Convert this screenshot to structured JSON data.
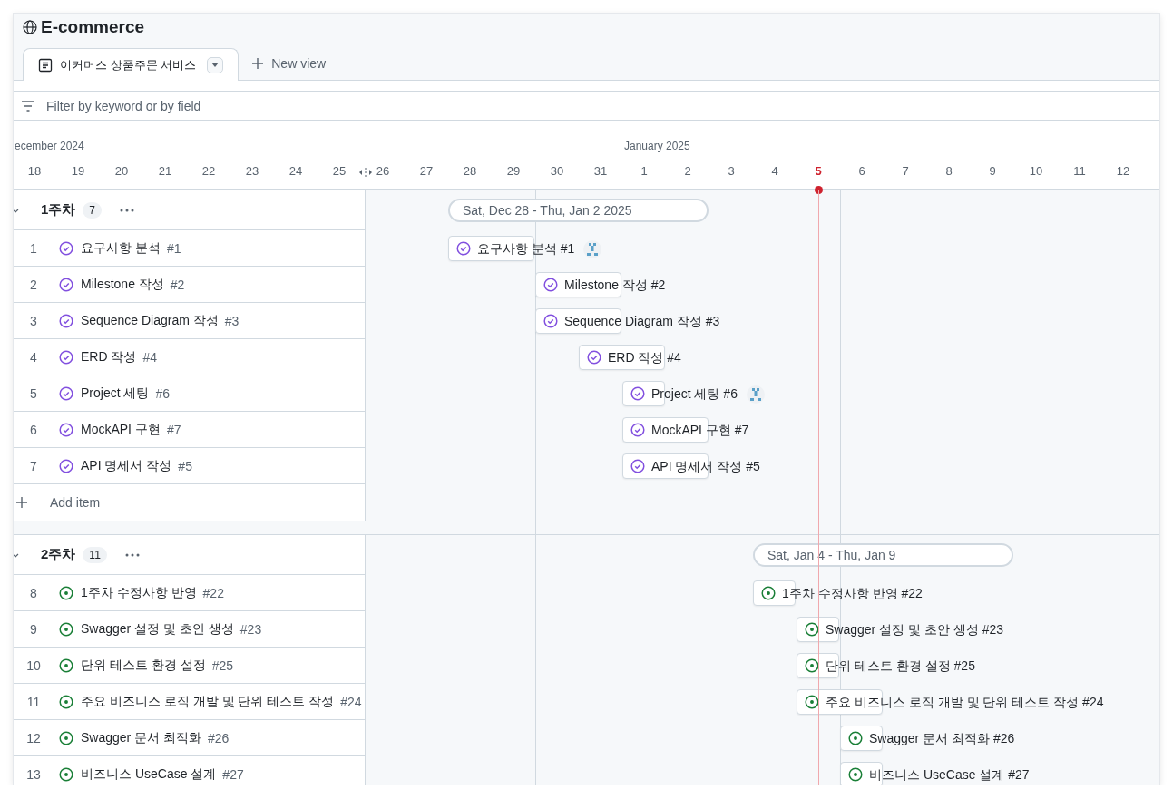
{
  "project": {
    "title": "E-commerce"
  },
  "views": [
    {
      "label": "이커머스 상품주문 서비스",
      "selected": true
    }
  ],
  "new_view": {
    "label": "New view"
  },
  "filter": {
    "placeholder": "Filter by keyword or by field"
  },
  "timeline": {
    "days": [
      {
        "label": "18",
        "today": false,
        "week_start": false,
        "month": "ecember 2024"
      },
      {
        "label": "19",
        "today": false,
        "week_start": false
      },
      {
        "label": "20",
        "today": false,
        "week_start": false
      },
      {
        "label": "21",
        "today": false,
        "week_start": false
      },
      {
        "label": "22",
        "today": false,
        "week_start": false
      },
      {
        "label": "23",
        "today": false,
        "week_start": false
      },
      {
        "label": "24",
        "today": false,
        "week_start": false
      },
      {
        "label": "25",
        "today": false,
        "week_start": false
      },
      {
        "label": "26",
        "today": false,
        "week_start": false
      },
      {
        "label": "27",
        "today": false,
        "week_start": false
      },
      {
        "label": "28",
        "today": false,
        "week_start": false
      },
      {
        "label": "29",
        "today": false,
        "week_start": false
      },
      {
        "label": "30",
        "today": false,
        "week_start": true
      },
      {
        "label": "31",
        "today": false,
        "week_start": false
      },
      {
        "label": "1",
        "today": false,
        "week_start": false,
        "month": "January 2025"
      },
      {
        "label": "2",
        "today": false,
        "week_start": false
      },
      {
        "label": "3",
        "today": false,
        "week_start": false
      },
      {
        "label": "4",
        "today": false,
        "week_start": false
      },
      {
        "label": "5",
        "today": true,
        "week_start": false
      },
      {
        "label": "6",
        "today": false,
        "week_start": true
      },
      {
        "label": "7",
        "today": false,
        "week_start": false
      },
      {
        "label": "8",
        "today": false,
        "week_start": false
      },
      {
        "label": "9",
        "today": false,
        "week_start": false
      },
      {
        "label": "10",
        "today": false,
        "week_start": false
      },
      {
        "label": "11",
        "today": false,
        "week_start": false
      },
      {
        "label": "12",
        "today": false,
        "week_start": false
      }
    ]
  },
  "groups": [
    {
      "title": "1주차",
      "count": "7",
      "expanded": true,
      "range": "Sat, Dec 28 - Thu, Jan 2 2025",
      "add_item": "Add item",
      "schedule": [
        false,
        false,
        true,
        true,
        true,
        true,
        true,
        true,
        false,
        false,
        false,
        false,
        false,
        false,
        false,
        false,
        false,
        false
      ],
      "items": [
        {
          "number": "1",
          "title": "요구사항 분석",
          "ref": "#1",
          "bar_label": "요구사항 분석 #1",
          "kind": "closed",
          "assigned": true,
          "schedule": [
            false,
            false,
            true,
            true,
            false,
            false,
            false,
            false,
            false,
            false,
            false,
            false,
            false,
            false,
            false,
            false,
            false,
            false
          ]
        },
        {
          "number": "2",
          "title": "Milestone 작성",
          "ref": "#2",
          "bar_label": "Milestone 작성 #2",
          "kind": "closed",
          "assigned": false,
          "schedule": [
            false,
            false,
            false,
            false,
            true,
            true,
            false,
            false,
            false,
            false,
            false,
            false,
            false,
            false,
            false,
            false,
            false,
            false
          ]
        },
        {
          "number": "3",
          "title": "Sequence Diagram 작성",
          "ref": "#3",
          "bar_label": "Sequence Diagram 작성 #3",
          "kind": "closed",
          "assigned": false,
          "schedule": [
            false,
            false,
            false,
            false,
            true,
            true,
            false,
            false,
            false,
            false,
            false,
            false,
            false,
            false,
            false,
            false,
            false,
            false
          ]
        },
        {
          "number": "4",
          "title": "ERD 작성",
          "ref": "#4",
          "bar_label": "ERD 작성 #4",
          "kind": "closed",
          "assigned": false,
          "schedule": [
            false,
            false,
            false,
            false,
            false,
            true,
            true,
            false,
            false,
            false,
            false,
            false,
            false,
            false,
            false,
            false,
            false,
            false
          ]
        },
        {
          "number": "5",
          "title": "Project 세팅",
          "ref": "#6",
          "bar_label": "Project 세팅 #6",
          "kind": "closed",
          "assigned": true,
          "schedule": [
            false,
            false,
            false,
            false,
            false,
            false,
            true,
            false,
            false,
            false,
            false,
            false,
            false,
            false,
            false,
            false,
            false,
            false
          ]
        },
        {
          "number": "6",
          "title": "MockAPI 구현",
          "ref": "#7",
          "bar_label": "MockAPI 구현 #7",
          "kind": "closed",
          "assigned": false,
          "schedule": [
            false,
            false,
            false,
            false,
            false,
            false,
            true,
            true,
            false,
            false,
            false,
            false,
            false,
            false,
            false,
            false,
            false,
            false
          ]
        },
        {
          "number": "7",
          "title": "API 명세서 작성",
          "ref": "#5",
          "bar_label": "API 명세서 작성 #5",
          "kind": "closed",
          "assigned": false,
          "schedule": [
            false,
            false,
            false,
            false,
            false,
            false,
            true,
            true,
            false,
            false,
            false,
            false,
            false,
            false,
            false,
            false,
            false,
            false
          ]
        }
      ]
    },
    {
      "title": "2주차",
      "count": "11",
      "expanded": true,
      "range": "Sat, Jan 4 - Thu, Jan 9",
      "schedule": [
        false,
        false,
        false,
        false,
        false,
        false,
        false,
        false,
        false,
        true,
        true,
        true,
        true,
        true,
        true,
        false,
        false,
        false
      ],
      "items": [
        {
          "number": "8",
          "title": "1주차 수정사항 반영",
          "ref": "#22",
          "bar_label": "1주차 수정사항 반영 #22",
          "kind": "open",
          "assigned": false,
          "schedule": [
            false,
            false,
            false,
            false,
            false,
            false,
            false,
            false,
            false,
            true,
            false,
            false,
            false,
            false,
            false,
            false,
            false,
            false
          ]
        },
        {
          "number": "9",
          "title": "Swagger 설정 및 초안 생성",
          "ref": "#23",
          "bar_label": "Swagger 설정 및 초안 생성 #23",
          "kind": "open",
          "assigned": false,
          "schedule": [
            false,
            false,
            false,
            false,
            false,
            false,
            false,
            false,
            false,
            false,
            true,
            false,
            false,
            false,
            false,
            false,
            false,
            false
          ]
        },
        {
          "number": "10",
          "title": "단위 테스트 환경 설정",
          "ref": "#25",
          "bar_label": "단위 테스트 환경 설정 #25",
          "kind": "open",
          "assigned": false,
          "schedule": [
            false,
            false,
            false,
            false,
            false,
            false,
            false,
            false,
            false,
            false,
            true,
            false,
            false,
            false,
            false,
            false,
            false,
            false
          ]
        },
        {
          "number": "11",
          "title": "주요 비즈니스 로직 개발 및 단위 테스트 작성",
          "ref": "#24",
          "bar_label": "주요 비즈니스 로직 개발 및 단위 테스트 작성 #24",
          "kind": "open",
          "assigned": false,
          "schedule": [
            false,
            false,
            false,
            false,
            false,
            false,
            false,
            false,
            false,
            false,
            true,
            true,
            false,
            false,
            false,
            false,
            false,
            false
          ]
        },
        {
          "number": "12",
          "title": "Swagger 문서 최적화",
          "ref": "#26",
          "bar_label": "Swagger 문서 최적화 #26",
          "kind": "open",
          "assigned": false,
          "schedule": [
            false,
            false,
            false,
            false,
            false,
            false,
            false,
            false,
            false,
            false,
            false,
            true,
            false,
            false,
            false,
            false,
            false,
            false
          ]
        },
        {
          "number": "13",
          "title": "비즈니스 UseCase 설계",
          "ref": "#27",
          "bar_label": "비즈니스 UseCase 설계 #27",
          "kind": "open",
          "assigned": false,
          "schedule": [
            false,
            false,
            false,
            false,
            false,
            false,
            false,
            false,
            false,
            false,
            false,
            true,
            false,
            false,
            false,
            false,
            false,
            false
          ]
        }
      ]
    }
  ]
}
